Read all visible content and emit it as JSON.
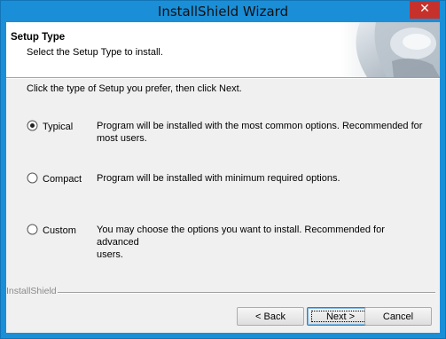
{
  "window": {
    "title": "InstallShield Wizard",
    "close_glyph": "✕"
  },
  "header": {
    "title": "Setup Type",
    "subtitle": "Select the Setup Type to install."
  },
  "instruction": "Click the type of Setup you prefer, then click Next.",
  "options": [
    {
      "label": "Typical",
      "selected": true,
      "desc_1": "Program will be installed with the most common options.  Recommended for",
      "desc_2": "most users."
    },
    {
      "label": "Compact",
      "selected": false,
      "desc_1": "Program will be installed with minimum required options.",
      "desc_2": ""
    },
    {
      "label": "Custom",
      "selected": false,
      "desc_1": "You may choose the options you want to install. Recommended for advanced",
      "desc_2": "users."
    }
  ],
  "brand": "InstallShield",
  "buttons": {
    "back": "< Back",
    "next": "Next >",
    "cancel": "Cancel"
  },
  "colors": {
    "title_bar": "#1a8fd8",
    "close_button": "#c7312b",
    "dialog_bg": "#f0f0f0"
  }
}
